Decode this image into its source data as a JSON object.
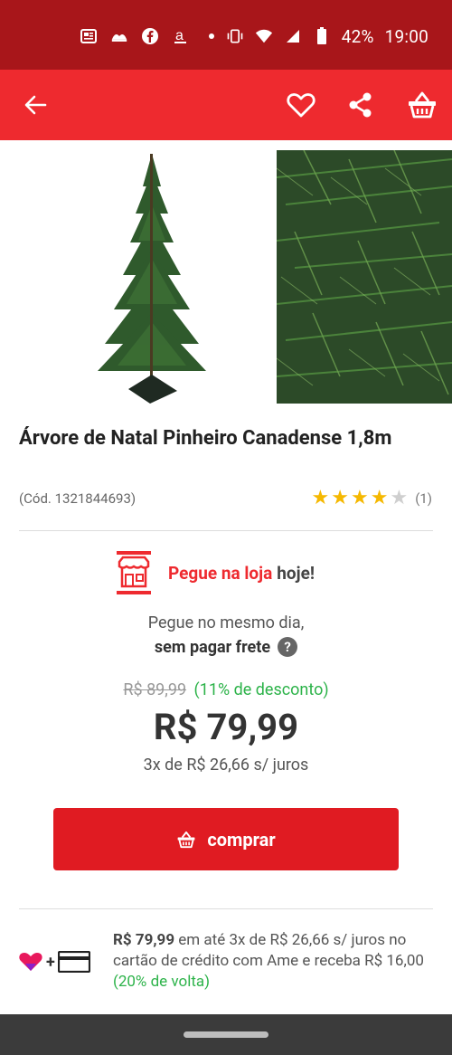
{
  "status_bar": {
    "battery": "42%",
    "time": "19:00",
    "icons": [
      "news-icon",
      "bank-icon",
      "facebook-icon",
      "amazon-icon",
      "dot-icon",
      "vibrate-icon",
      "wifi-icon",
      "signal-icon",
      "battery-icon"
    ]
  },
  "app_bar": {
    "icons": [
      "back-arrow-icon",
      "heart-icon",
      "share-icon",
      "basket-icon"
    ],
    "color": "#ee2a2f"
  },
  "product": {
    "title": "Árvore de Natal Pinheiro Canadense 1,8m",
    "code": "(Cód. 1321844693)",
    "rating": 4,
    "rating_max": 5,
    "rating_count": "(1)"
  },
  "store_pickup": {
    "label": "Pegue na loja",
    "today": "hoje!",
    "same_day": "Pegue no mesmo dia,",
    "no_freight": "sem pagar frete"
  },
  "pricing": {
    "old_price": "R$ 89,99",
    "discount": "(11% de desconto)",
    "price": "R$ 79,99",
    "installments": "3x de R$ 26,66 s/ juros"
  },
  "buy_button": {
    "label": "comprar"
  },
  "ame": {
    "price": "R$ 79,99",
    "text1": " em até 3x de R$ 26,66 s/ juros no cartão de crédito  com Ame e receba R$ 16,00 ",
    "cashback": "(20% de volta)"
  },
  "colors": {
    "status_bar": "#a8161a",
    "accent": "#ee2a2f",
    "green": "#2db34a",
    "star": "#f5b800"
  }
}
